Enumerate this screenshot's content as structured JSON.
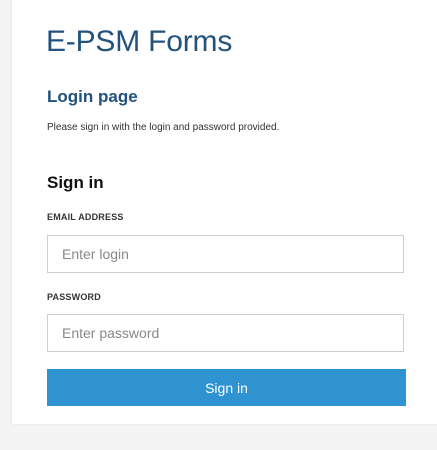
{
  "app": {
    "title": "E-PSM Forms"
  },
  "login": {
    "page_title": "Login page",
    "instructions": "Please sign in with the login and password provided.",
    "heading": "Sign in",
    "email_label": "EMAIL ADDRESS",
    "email_placeholder": "Enter login",
    "email_value": "",
    "password_label": "PASSWORD",
    "password_placeholder": "Enter password",
    "password_value": "",
    "submit_label": "Sign in"
  },
  "colors": {
    "title": "#23527c",
    "button": "#2f93d1",
    "background": "#f4f4f4"
  }
}
